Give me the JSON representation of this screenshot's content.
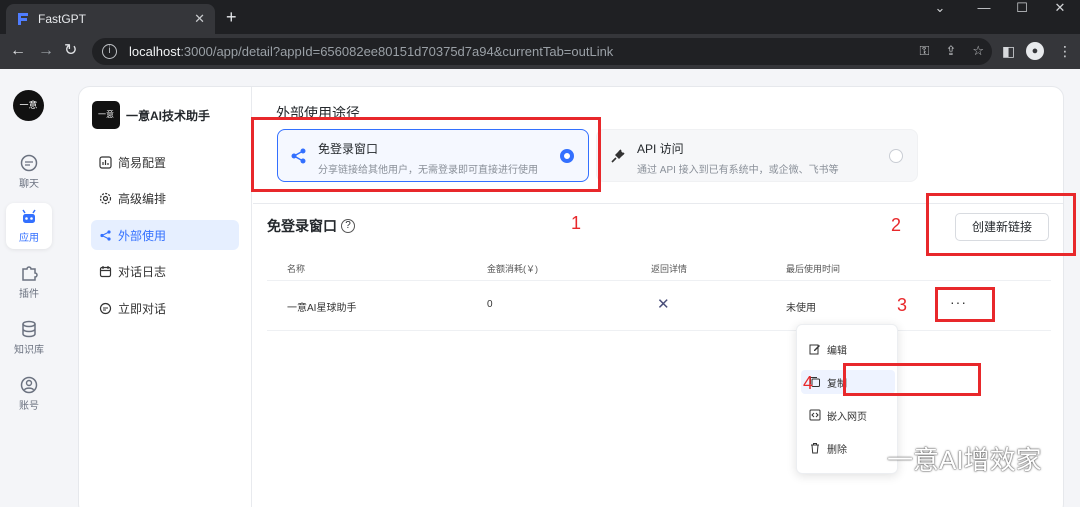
{
  "browser": {
    "tab_title": "FastGPT",
    "tab_close": "✕",
    "new_tab": "+",
    "window_controls": [
      "⌄",
      "—",
      "☐",
      "✕"
    ],
    "url_host": "localhost",
    "url_rest": ":3000/app/detail?appId=656082ee80151d70375d7a94&currentTab=outLink"
  },
  "app_nav": {
    "logo_text": "一意",
    "items": [
      {
        "label": "聊天",
        "icon": "chat-icon"
      },
      {
        "label": "应用",
        "icon": "robot-icon"
      },
      {
        "label": "插件",
        "icon": "puzzle-icon"
      },
      {
        "label": "知识库",
        "icon": "database-icon"
      },
      {
        "label": "账号",
        "icon": "user-icon"
      }
    ]
  },
  "side_panel": {
    "avatar_text": "一意",
    "app_name": "一意AI技术助手",
    "menu": [
      {
        "label": "简易配置",
        "icon": "chart-icon"
      },
      {
        "label": "高级编排",
        "icon": "gear-icon"
      },
      {
        "label": "外部使用",
        "icon": "share-icon"
      },
      {
        "label": "对话日志",
        "icon": "calendar-icon"
      },
      {
        "label": "立即对话",
        "icon": "chat-bubble-icon"
      }
    ]
  },
  "content": {
    "section_title": "外部使用途径",
    "options": [
      {
        "title": "免登录窗口",
        "desc": "分享链接给其他用户，无需登录即可直接进行使用",
        "selected": true
      },
      {
        "title": "API 访问",
        "desc": "通过 API 接入到已有系统中，或企微、飞书等",
        "selected": false
      }
    ],
    "sub_title": "免登录窗口",
    "help": "?",
    "create_button": "创建新链接",
    "table": {
      "headers": [
        "名称",
        "金额消耗(￥)",
        "返回详情",
        "最后使用时间"
      ],
      "rows": [
        {
          "name": "一意AI星球助手",
          "cost": "0",
          "detail": "✕",
          "last_used": "未使用",
          "more": "···"
        }
      ]
    },
    "dropdown": [
      "编辑",
      "复制",
      "嵌入网页",
      "删除"
    ]
  },
  "annotations": [
    "1",
    "2",
    "3",
    "4"
  ],
  "watermark": "一意AI增效家",
  "colors": {
    "accent": "#3370ff",
    "annotation": "#e8282b"
  }
}
